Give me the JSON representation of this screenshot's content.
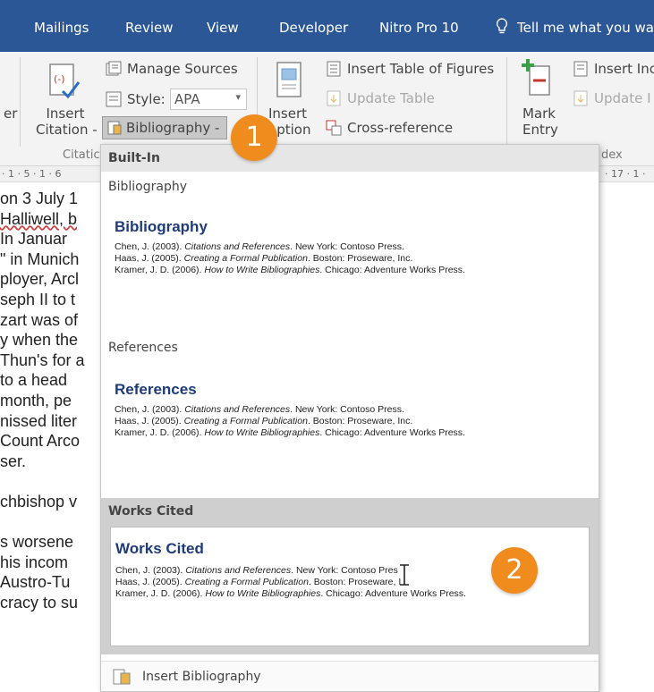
{
  "tabs": [
    "Mailings",
    "Review",
    "View",
    "Developer",
    "Nitro Pro 10"
  ],
  "tell_me": "Tell me what you wa",
  "ribbon": {
    "er_label": "er",
    "insert_citation": [
      "Insert",
      "Citation -"
    ],
    "manage_sources": "Manage Sources",
    "style_label": "Style:",
    "style_value": "APA",
    "bibliography_button": "Bibliography -",
    "citations_group": "Citatic",
    "insert_caption": [
      "Insert",
      "aption"
    ],
    "insert_table_of_figures": "Insert Table of Figures",
    "update_table": "Update Table",
    "cross_reference": "Cross-reference",
    "mark_entry": [
      "Mark",
      "Entry"
    ],
    "insert_index": "Insert Inc",
    "update_index": "Update I",
    "index_group": "dex"
  },
  "ruler": {
    "left": "· 1 · 5 · 1 · 6",
    "right": "· 17 · 1 ·"
  },
  "document_lines": [
    "on 3 July 1",
    "Halliwell, b",
    "  In Januar",
    "\" in Munich",
    "ployer, Arcl",
    "seph II to t",
    "zart was of",
    "y when the",
    "Thun's for a",
    " to a head",
    " month, pe",
    "nissed liter",
    " Count Arco",
    "ser.",
    "",
    "chbishop v",
    "",
    "s worsene",
    " his incom",
    " Austro-Tu",
    "cracy to su"
  ],
  "dropdown": {
    "builtin_header": "Built-In",
    "sections": [
      {
        "header": "Bibliography",
        "title": "Bibliography",
        "refs": [
          {
            "pre": "Chen, J. (2003). ",
            "italic": "Citations and References",
            "post": ". New York: Contoso Press."
          },
          {
            "pre": "Haas, J. (2005). ",
            "italic": "Creating a Formal Publication",
            "post": ". Boston: Proseware, Inc."
          },
          {
            "pre": "Kramer, J. D. (2006). ",
            "italic": "How to Write Bibliographies",
            "post": ". Chicago: Adventure Works Press."
          }
        ]
      },
      {
        "header": "References",
        "title": "References",
        "refs": [
          {
            "pre": "Chen, J. (2003). ",
            "italic": "Citations and References",
            "post": ". New York: Contoso Press."
          },
          {
            "pre": "Haas, J. (2005). ",
            "italic": "Creating a Formal Publication",
            "post": ". Boston: Proseware, Inc."
          },
          {
            "pre": "Kramer, J. D. (2006). ",
            "italic": "How to Write Bibliographies",
            "post": ". Chicago: Adventure Works Press."
          }
        ]
      },
      {
        "header": "Works Cited",
        "title": "Works Cited",
        "refs": [
          {
            "pre": "Chen, J. (2003). ",
            "italic": "Citations and References",
            "post": ". New York: Contoso Pres"
          },
          {
            "pre": "Haas, J. (2005). ",
            "italic": "Creating a Formal Publication",
            "post": ". Boston: Proseware, I"
          },
          {
            "pre": "Kramer, J. D. (2006). ",
            "italic": "How to Write Bibliographies",
            "post": ". Chicago: Adventure Works Press."
          }
        ]
      }
    ],
    "insert_bibliography": "Insert Bibliography"
  },
  "badges": [
    "1",
    "2"
  ],
  "colors": {
    "ribbon_tabs": "#2b5797",
    "badge": "#f08c1e",
    "entry_title": "#1f3b7a"
  }
}
